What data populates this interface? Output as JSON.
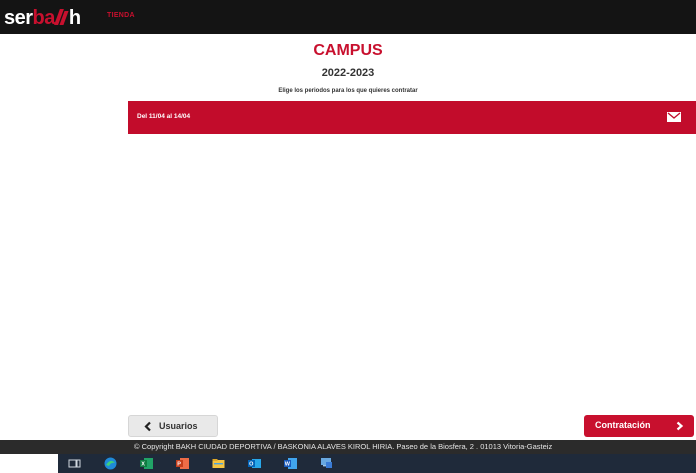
{
  "header": {
    "logo_text_white": "ser",
    "logo_text_red": "ba",
    "logo_text_tail": "h",
    "nav_tienda": "TIENDA"
  },
  "main": {
    "title": "CAMPUS",
    "season": "2022-2023",
    "instruction": "Elige los periodos para los que quieres contratar",
    "periods": [
      {
        "label": "Del 11/04 al 14/04",
        "icon": "mail-icon"
      }
    ]
  },
  "actions": {
    "back_label": "Usuarios",
    "next_label": "Contratación"
  },
  "footer": {
    "copyright": "© Copyright BAKH CIUDAD DEPORTIVA / BASKONIA ALAVES KIROL HIRIA. Paseo de la Biosfera, 2 . 01013 Vitoria-Gasteiz"
  },
  "taskbar": {
    "icons": [
      "task-view-icon",
      "edge-icon",
      "excel-icon",
      "powerpoint-icon",
      "file-explorer-icon",
      "outlook-icon",
      "word-icon",
      "remote-desktop-icon"
    ]
  },
  "colors": {
    "brand_red": "#c8102e",
    "top_bar": "#141414",
    "footer": "#2b2b2b",
    "taskbar": "#1f2a3a"
  }
}
